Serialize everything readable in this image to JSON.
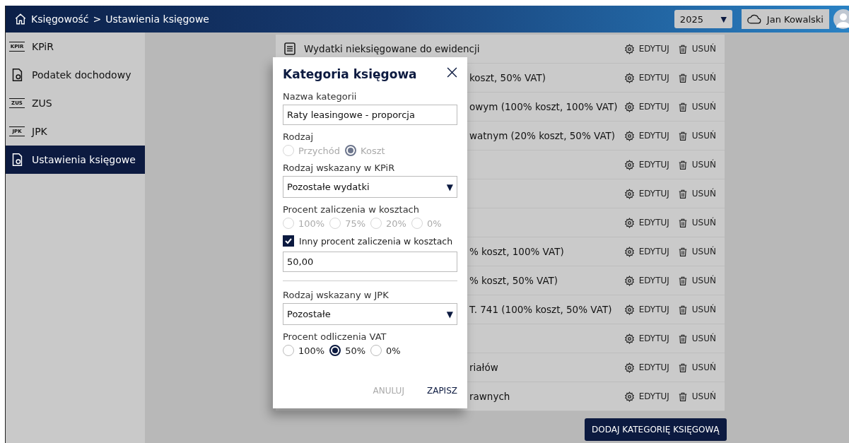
{
  "header": {
    "breadcrumb": [
      "Księgowość",
      "Ustawienia księgowe"
    ],
    "separator": ">",
    "year": "2025",
    "year_caret": "▼",
    "user": "Jan Kowalski"
  },
  "sidebar": {
    "items": [
      {
        "label": "KPiR",
        "icon": "KPIR",
        "selected": false
      },
      {
        "label": "Podatek dochodowy",
        "selected": false
      },
      {
        "label": "ZUS",
        "icon": "ZUS",
        "selected": false
      },
      {
        "label": "JPK",
        "icon": "JPK",
        "selected": false
      },
      {
        "label": "Ustawienia księgowe",
        "selected": true
      }
    ]
  },
  "categories": {
    "rows": [
      {
        "name": "Wydatki nieksięgowane do ewidencji",
        "kind": "full",
        "edit": "EDYTUJ",
        "delete": "USUŃ"
      },
      {
        "name": "koszt, 50% VAT)",
        "kind": "covered",
        "edit": "EDYTUJ",
        "delete": "USUŃ"
      },
      {
        "name": "owym (100% koszt, 100% VAT)",
        "kind": "covered",
        "edit": "EDYTUJ",
        "delete": "USUŃ"
      },
      {
        "name": "watnym (20% koszt, 50% VAT)",
        "kind": "covered",
        "edit": "EDYTUJ",
        "delete": "USUŃ"
      },
      {
        "kind": "covered",
        "edit": "EDYTUJ",
        "delete": "USUŃ"
      },
      {
        "kind": "covered",
        "edit": "EDYTUJ",
        "delete": "USUŃ"
      },
      {
        "kind": "covered",
        "edit": "EDYTUJ",
        "delete": "USUŃ"
      },
      {
        "name": "% koszt, 100% VAT)",
        "kind": "covered",
        "edit": "EDYTUJ",
        "delete": "USUŃ"
      },
      {
        "name": "% koszt, 50% VAT)",
        "kind": "covered",
        "edit": "EDYTUJ",
        "delete": "USUŃ"
      },
      {
        "name": "T. 741 (100% koszt, 50% VAT)",
        "kind": "covered",
        "edit": "EDYTUJ",
        "delete": "USUŃ"
      },
      {
        "kind": "covered",
        "edit": "EDYTUJ",
        "delete": "USUŃ"
      },
      {
        "name": "riałów",
        "kind": "covered",
        "edit": "EDYTUJ",
        "delete": "USUŃ"
      },
      {
        "name": "rawnych",
        "kind": "covered",
        "edit": "EDYTUJ",
        "delete": "USUŃ"
      }
    ],
    "add_button": "DODAJ KATEGORIĘ KSIĘGOWĄ"
  },
  "dialog": {
    "title": "Kategoria księgowa",
    "fields": [
      {
        "kind": "text",
        "label": "Nazwa kategorii",
        "value": "Raty leasingowe - proporcja"
      },
      {
        "kind": "radio",
        "label": "Rodzaj",
        "disabled": true,
        "options": [
          {
            "label": "Przychód",
            "selected": false
          },
          {
            "label": "Koszt",
            "selected": true
          }
        ]
      },
      {
        "kind": "select",
        "label": "Rodzaj wskazany w KPiR",
        "value": "Pozostałe wydatki",
        "caret": "▼"
      },
      {
        "kind": "radio",
        "label": "Procent zaliczenia w kosztach",
        "disabled": true,
        "options": [
          {
            "label": "100%",
            "selected": false
          },
          {
            "label": "75%",
            "selected": false
          },
          {
            "label": "20%",
            "selected": false
          },
          {
            "label": "0%",
            "selected": false
          }
        ]
      },
      {
        "kind": "checkbox",
        "label": "Inny procent zaliczenia w kosztach",
        "checked": true
      },
      {
        "kind": "text",
        "value": "50,00"
      },
      {
        "kind": "divider"
      },
      {
        "kind": "select",
        "label": "Rodzaj wskazany w JPK",
        "value": "Pozostałe",
        "caret": "▼"
      },
      {
        "kind": "radio",
        "label": "Procent odliczenia VAT",
        "disabled": false,
        "options": [
          {
            "label": "100%",
            "selected": false
          },
          {
            "label": "50%",
            "selected": true
          },
          {
            "label": "0%",
            "selected": false
          }
        ]
      }
    ],
    "buttons": [
      {
        "label": "ANULUJ",
        "disabled": true
      },
      {
        "label": "ZAPISZ",
        "disabled": false
      }
    ]
  }
}
